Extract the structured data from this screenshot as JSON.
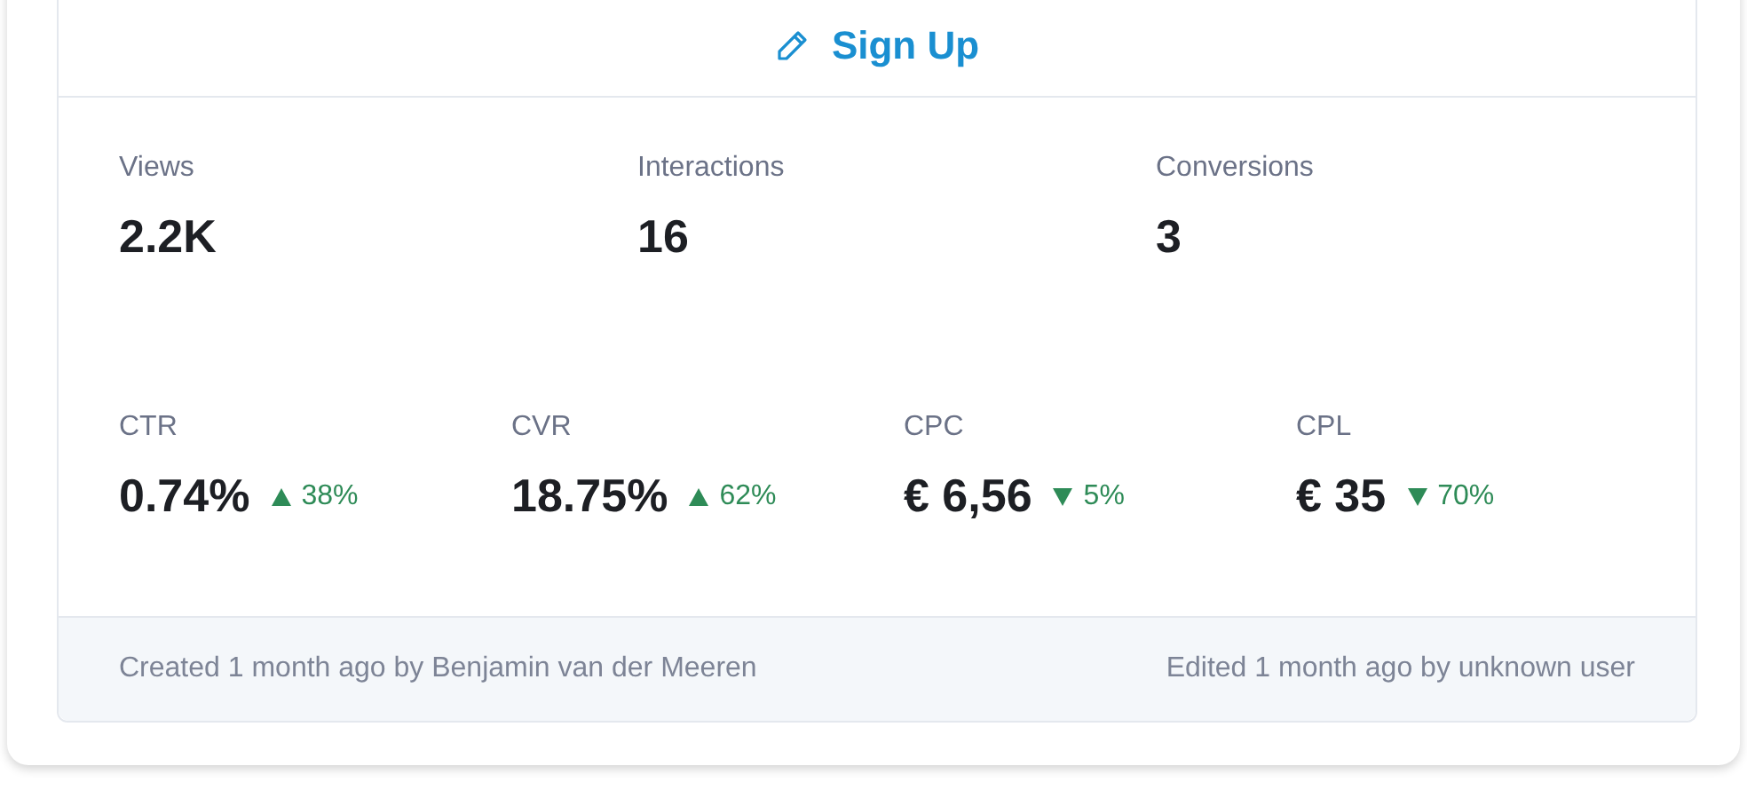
{
  "header": {
    "action": "Sign Up"
  },
  "stats": [
    {
      "label": "Views",
      "value": "2.2K"
    },
    {
      "label": "Interactions",
      "value": "16"
    },
    {
      "label": "Conversions",
      "value": "3"
    }
  ],
  "metrics": [
    {
      "label": "CTR",
      "value": "0.74%",
      "kind": "rise",
      "change": "38%"
    },
    {
      "label": "CVR",
      "value": "18.75%",
      "kind": "rise",
      "change": "62%"
    },
    {
      "label": "CPC",
      "value": "€ 6,56",
      "kind": "fall",
      "change": "5%"
    },
    {
      "label": "CPL",
      "value": "€ 35",
      "kind": "fall",
      "change": "70%"
    }
  ],
  "footer": {
    "created": "Created 1 month ago by Benjamin van der Meeren",
    "edited": "Edited 1 month ago by unknown user"
  }
}
